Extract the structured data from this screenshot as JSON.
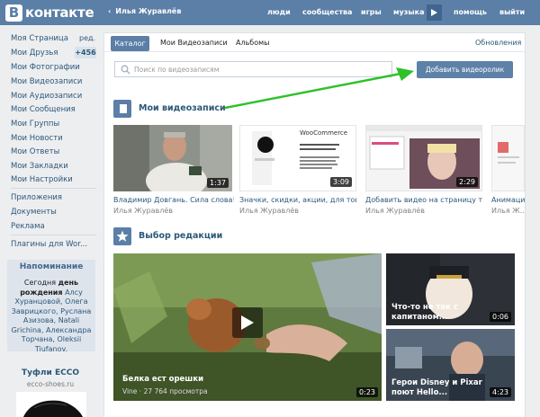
{
  "header": {
    "logo_letter": "В",
    "logo_text": "контакте",
    "back_name": "Илья Журавлёв",
    "nav": [
      "люди",
      "сообщества",
      "игры",
      "музыка",
      "помощь",
      "выйти"
    ]
  },
  "menu": {
    "items": [
      "Моя Страница",
      "Мои Друзья",
      "Мои Фотографии",
      "Мои Видеозаписи",
      "Мои Аудиозаписи",
      "Мои Сообщения",
      "Мои Группы",
      "Мои Новости",
      "Мои Ответы",
      "Мои Закладки",
      "Мои Настройки"
    ],
    "edit_label": "ред.",
    "friends_badge": "+456",
    "items2": [
      "Приложения",
      "Документы",
      "Реклама"
    ],
    "plugins": "Плагины для Wor..."
  },
  "reminder": {
    "title": "Напоминание",
    "today": "Сегодня",
    "birthday": "день рождения",
    "names": "Алсу Хуранцовой, Олега Заврицкого, Руслана Азизова, Natali Grichina, Александра Торчана, Oleksii Tiufanov."
  },
  "ad": {
    "title": "Туфли ECCO",
    "domain": "ecco-shoes.ru"
  },
  "tabs": {
    "catalog": "Каталог",
    "my_videos": "Мои Видеозаписи",
    "albums": "Альбомы",
    "updates": "Обновления"
  },
  "search": {
    "placeholder": "Поиск по видеозаписям"
  },
  "add_button": "Добавить видеоролик",
  "my_videos": {
    "title": "Мои видеозаписи",
    "items": [
      {
        "title": "Владимир Довгань. Сила слова! З...",
        "author": "Илья Журавлёв",
        "duration": "1:37"
      },
      {
        "title": "Значки, скидки, акции, для товар...",
        "author": "Илья Журавлёв",
        "duration": "3:09",
        "thumb_heading": "WooCommerce"
      },
      {
        "title": "Добавить видео на страницу тов...",
        "author": "Илья Журавлёв",
        "duration": "2:29"
      },
      {
        "title": "Анимаци...",
        "author": "Илья Ж..."
      }
    ]
  },
  "editors": {
    "title": "Выбор редакции",
    "big": {
      "title": "Белка ест орешки",
      "meta": "Vine · 27 764 просмотра",
      "duration": "0:23"
    },
    "small": [
      {
        "title_line1": "Что-то не так с",
        "title_line2": "капитаном...",
        "duration": "0:06"
      },
      {
        "title_line1": "Герои Disney и Pixar",
        "title_line2": "поют Hello...",
        "duration": "4:23"
      }
    ]
  },
  "colors": {
    "header": "#5b7fa6",
    "link": "#2b587a",
    "accent_arrow": "#2fc12a",
    "button": "#5e81a8"
  }
}
